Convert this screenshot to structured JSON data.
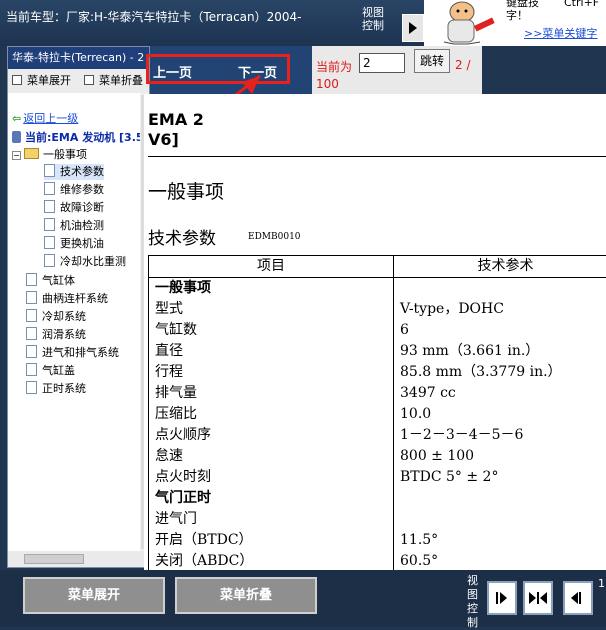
{
  "top_bar": {
    "current_car": "当前车型：厂家:H-华泰汽车特拉卡（Terracan）2004-",
    "view_control": "视图控制",
    "tip_line1": "键盘技",
    "tip_key": "Ctrl+F",
    "tip_line2": "字！",
    "tip_link": ">>菜单关键字"
  },
  "left_panel": {
    "title": "华泰-特拉卡(Terrecan) - 2",
    "expand_menu": "菜单展开",
    "collapse_menu": "菜单折叠",
    "back": "返回上一级",
    "current": "当前:EMA 发动机 [3.5",
    "tree": [
      "一般事项",
      "技术参数",
      "维修参数",
      "故障诊断",
      "机油检测",
      "更换机油",
      "冷却水比重测",
      "气缸体",
      "曲柄连杆系统",
      "冷却系统",
      "润滑系统",
      "进气和排气系统",
      "气缸盖",
      "正时系统"
    ]
  },
  "nav": {
    "prev": "上一页",
    "next": "下一页",
    "current_label": "当前为",
    "page_value": "2",
    "jump": "跳转",
    "total_a": "2 /",
    "total_b": "100"
  },
  "document": {
    "heading_line1": "EMA 2",
    "heading_line2": "V6]",
    "section": "一般事项",
    "subsection": "技术参数",
    "code": "EDMB0010",
    "table_headers": [
      "项目",
      "技术参术"
    ],
    "rows": [
      {
        "item": "一般事项",
        "value": "",
        "bold": true
      },
      {
        "item": "型式",
        "value": "V-type，DOHC"
      },
      {
        "item": "气缸数",
        "value": "6"
      },
      {
        "item": "直径",
        "value": "93 mm（3.661 in.）"
      },
      {
        "item": "行程",
        "value": "85.8 mm（3.3779 in.）"
      },
      {
        "item": "排气量",
        "value": "3497 cc"
      },
      {
        "item": "压缩比",
        "value": "10.0"
      },
      {
        "item": "点火顺序",
        "value": "1－2－3－4－5－6"
      },
      {
        "item": "怠速",
        "value": "800 ± 100"
      },
      {
        "item": "点火时刻",
        "value": "BTDC 5°  ± 2°"
      },
      {
        "item": "气门正时",
        "value": "",
        "bold": true
      },
      {
        "item": "进气门",
        "value": ""
      },
      {
        "item": "开启（BTDC）",
        "value": "11.5°"
      },
      {
        "item": "关闭（ABDC）",
        "value": "60.5°"
      }
    ]
  },
  "bottom_bar": {
    "expand": "菜单展开",
    "collapse": "菜单折叠",
    "view_control": "视图控制",
    "page_hint": "1"
  },
  "colors": {
    "highlight": "#e8211c",
    "nav_bg": "#214474",
    "bar_bg": "#1c2f47"
  }
}
